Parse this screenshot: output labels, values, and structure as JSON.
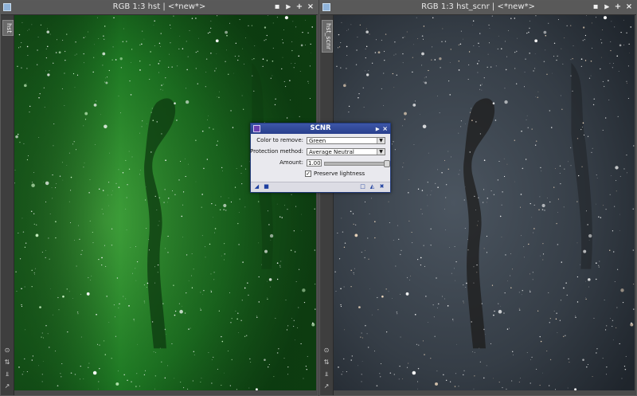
{
  "left_window": {
    "title": "RGB 1:3 hst | <*new*>",
    "tab_label": "hst",
    "buttons": [
      "▪",
      "⫸",
      "+",
      "×"
    ]
  },
  "right_window": {
    "title": "RGB 1:3 hst_scnr | <*new*>",
    "tab_label": "hst_scnr",
    "buttons": [
      "▪",
      "⫸",
      "+",
      "×"
    ]
  },
  "side_icons": [
    "⊙",
    "⇅",
    "⫫",
    "↗"
  ],
  "dialog": {
    "title": "SCNR",
    "color_to_remove_label": "Color to remove:",
    "color_to_remove_value": "Green",
    "protection_method_label": "Protection method:",
    "protection_method_value": "Average Neutral",
    "amount_label": "Amount:",
    "amount_value": "1.00",
    "preserve_lightness_label": "Preserve lightness",
    "preserve_lightness_checked": true
  },
  "colors": {
    "left_nebula": "#1f7a24",
    "right_nebula": "#3b4550",
    "dialog_title": "#2f4a9a"
  }
}
